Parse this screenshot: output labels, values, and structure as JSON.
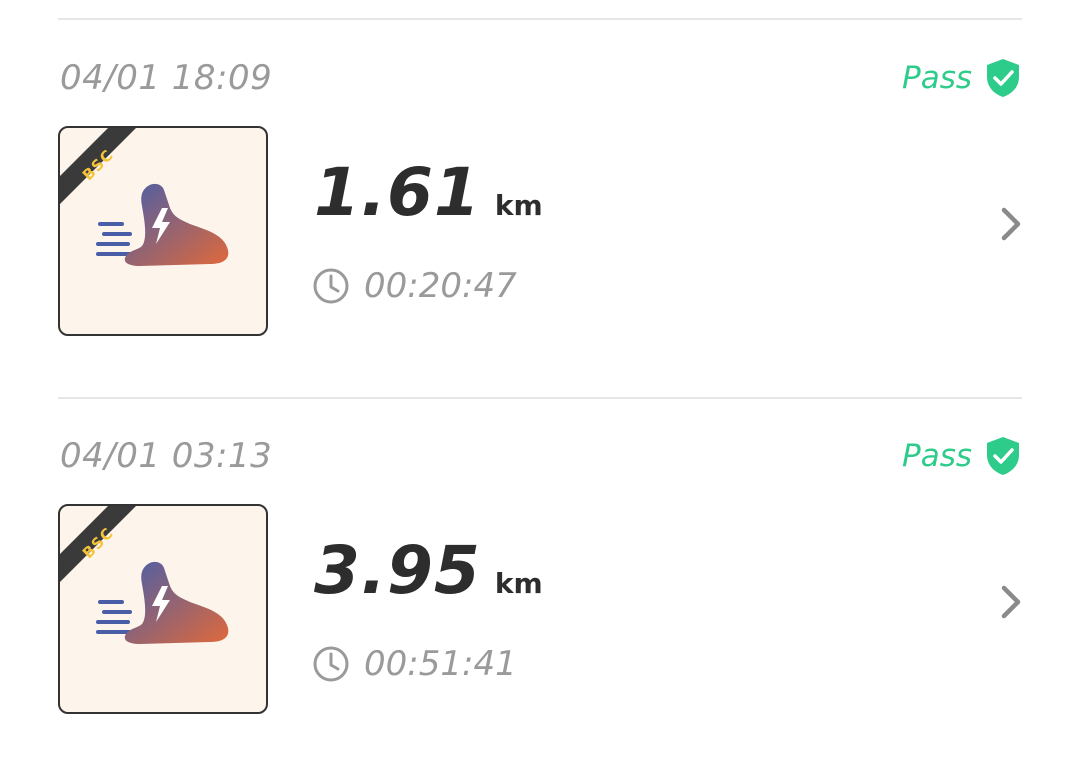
{
  "records": [
    {
      "timestamp": "04/01 18:09",
      "status": "Pass",
      "badge": "BSC",
      "distance": "1.61",
      "unit": "km",
      "duration": "00:20:47",
      "icon": "running-shoe-icon"
    },
    {
      "timestamp": "04/01 03:13",
      "status": "Pass",
      "badge": "BSC",
      "distance": "3.95",
      "unit": "km",
      "duration": "00:51:41",
      "icon": "running-shoe-icon"
    }
  ],
  "colors": {
    "pass": "#2ecc8a",
    "primary_text": "#2d2d2d",
    "secondary_text": "#9a9a9a",
    "divider": "#e6e6e6",
    "thumb_bg": "#fdf5ec",
    "badge_text": "#f5c33b",
    "shoe_gradient_start": "#4a5ea8",
    "shoe_gradient_end": "#e0693a"
  }
}
